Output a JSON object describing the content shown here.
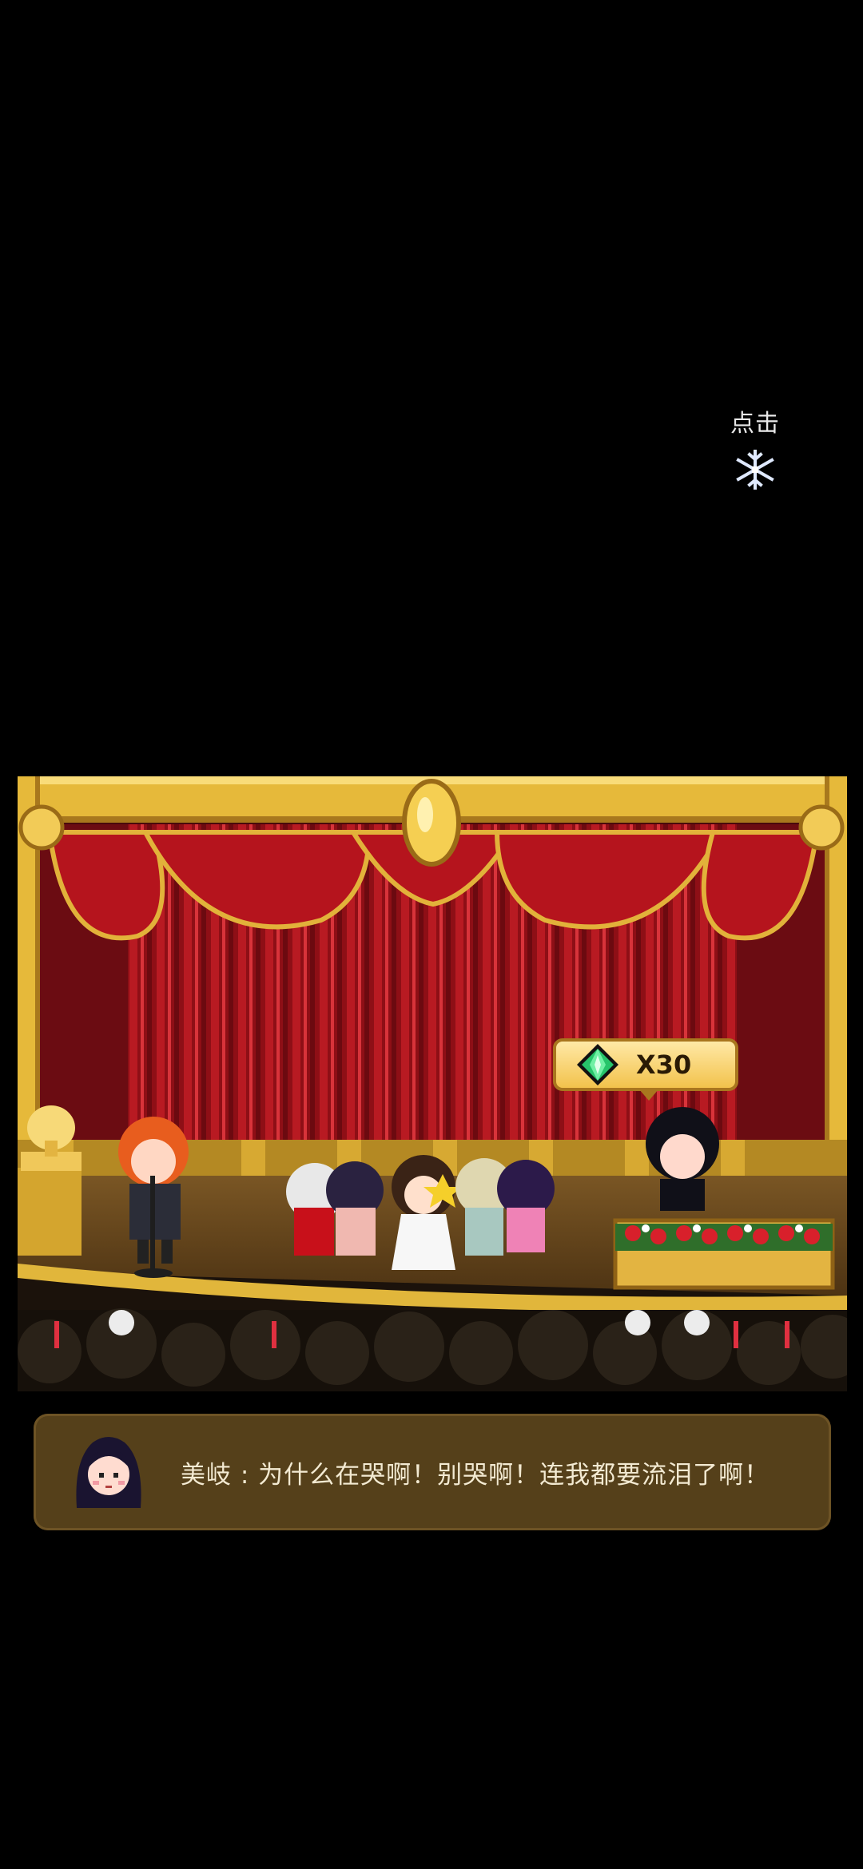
{
  "tap_hint": {
    "label": "点击",
    "icon": "snowflake-icon"
  },
  "reward": {
    "currency_icon": "green-gem-icon",
    "amount": "X30"
  },
  "dialogue": {
    "speaker_icon": "meiqi-portrait",
    "text": "美岐 : 为什么在哭啊！别哭啊！连我都要流泪了啊！"
  },
  "colors": {
    "background": "#000000",
    "curtain": "#a3121a",
    "gold_frame": "#e6b93a",
    "dialog_bg": "#55401a",
    "dialog_text": "#f3ead2"
  }
}
